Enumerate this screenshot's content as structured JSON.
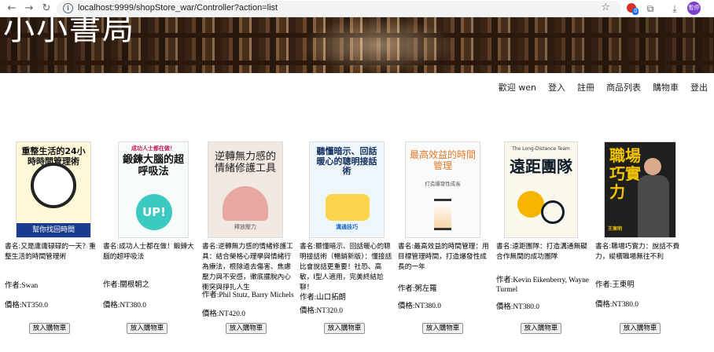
{
  "browser": {
    "url": "localhost:9999/shopStore_war/Controller?action=list",
    "badge_count": "0",
    "profile_initials": "暫停"
  },
  "banner": {
    "title": "小小書局"
  },
  "nav": {
    "welcome": "歡迎 wen",
    "login": "登入",
    "register": "註冊",
    "product_list": "商品列表",
    "cart": "購物車",
    "logout": "登出"
  },
  "colors": {
    "banner_wood": "#4a2e1a",
    "button_bg": "#f0f0f0"
  },
  "products": [
    {
      "cover_title": "重整生活的24小時時間管理術",
      "cover_sub": "幫你找回時間",
      "name": "書名:又是庸庸碌碌的一天？重整生活的時間管理術",
      "author": "作者:Swan",
      "price": "價格:NT350.0",
      "button": "放入購物車"
    },
    {
      "cover_title": "鍛鍊大腦的超呼吸法",
      "cover_sub": "成功人士都在做！",
      "name": "書名:成功人士都在做！鍛鍊大腦的超呼吸法",
      "author": "作者:關根朝之",
      "price": "價格:NT380.0",
      "button": "放入購物車"
    },
    {
      "cover_title": "逆轉無力感的情緒修護工具",
      "cover_sub": "釋放壓力",
      "name": "書名:逆轉無力感的情緒修護工具：結合榮格心理學與情緒行為療法，根除過去傷害、焦慮壓力與不安感，徹底擺脫內心衝突與掙扎人生",
      "author": "作者:Phil Stutz, Barry Michels",
      "price": "價格:NT420.0",
      "button": "放入購物車"
    },
    {
      "cover_title": "聽懂暗示、回話暖心的聰明接話術",
      "cover_sub": "溝通技巧",
      "name": "書名:聽懂暗示、回話暖心的聰明接話術（暢銷新版）：懂接話比會說話更重要！社恐、高敏，I型人適用，完美終結尬聊！",
      "author": "作者:山口拓朗",
      "price": "價格:NT320.0",
      "button": "放入購物車"
    },
    {
      "cover_title": "最高效益的時間管理",
      "cover_sub": "打造爆發性成長",
      "name": "書名:最高效益的時間管理：用目標管理時間，打造爆發性成長的一年",
      "author": "作者:粥左羅",
      "price": "價格:NT380.0",
      "button": "放入購物車"
    },
    {
      "cover_title": "遠距團隊",
      "cover_sub": "The Long-Distance Team",
      "name": "書名:遠距團隊：打造溝通無礙合作無間的成功團隊",
      "author": "作者:Kevin Eikenberry, Wayne Turmel",
      "price": "價格:NT380.0",
      "button": "放入購物車"
    },
    {
      "cover_title": "職場巧實力",
      "cover_sub": "王東明",
      "name": "書名:職場巧實力：說話不費力，縱橫職場無往不利",
      "author": "作者:王東明",
      "price": "價格:NT380.0",
      "button": "放入購物車"
    }
  ]
}
